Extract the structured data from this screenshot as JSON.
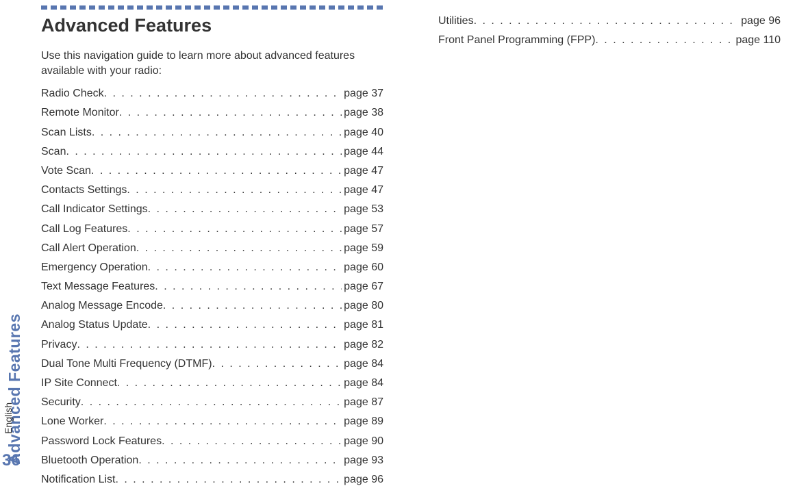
{
  "side_tab": "Advanced Features",
  "side_lang": "English",
  "page_number": "36",
  "title": "Advanced Features",
  "intro": "Use this navigation guide to learn more about advanced features available with your radio:",
  "toc_col1": [
    {
      "label": "Radio Check",
      "page": "page 37"
    },
    {
      "label": "Remote Monitor",
      "page": "page 38"
    },
    {
      "label": "Scan Lists",
      "page": "page 40"
    },
    {
      "label": "Scan",
      "page": "page 44"
    },
    {
      "label": "Vote Scan",
      "page": "page 47"
    },
    {
      "label": "Contacts Settings",
      "page": "page 47"
    },
    {
      "label": "Call Indicator Settings",
      "page": "page 53"
    },
    {
      "label": "Call Log Features",
      "page": "page 57"
    },
    {
      "label": "Call Alert Operation",
      "page": "page 59"
    },
    {
      "label": "Emergency Operation",
      "page": "page 60"
    },
    {
      "label": "Text Message Features",
      "page": "page 67"
    },
    {
      "label": "Analog Message Encode",
      "page": "page 80"
    },
    {
      "label": "Analog Status Update",
      "page": "page 81"
    },
    {
      "label": "Privacy",
      "page": "page 82"
    },
    {
      "label": "Dual Tone Multi Frequency (DTMF)",
      "page": "page 84"
    },
    {
      "label": "IP Site Connect",
      "page": "page 84"
    },
    {
      "label": "Security",
      "page": "page 87"
    },
    {
      "label": "Lone Worker",
      "page": "page 89"
    },
    {
      "label": "Password Lock Features",
      "page": "page 90"
    },
    {
      "label": "Bluetooth Operation",
      "page": "page 93"
    },
    {
      "label": "Notification List",
      "page": "page 96"
    }
  ],
  "toc_col2": [
    {
      "label": "Utilities",
      "page": "page 96"
    },
    {
      "label": "Front Panel Programming (FPP)",
      "page": "page 110"
    }
  ]
}
